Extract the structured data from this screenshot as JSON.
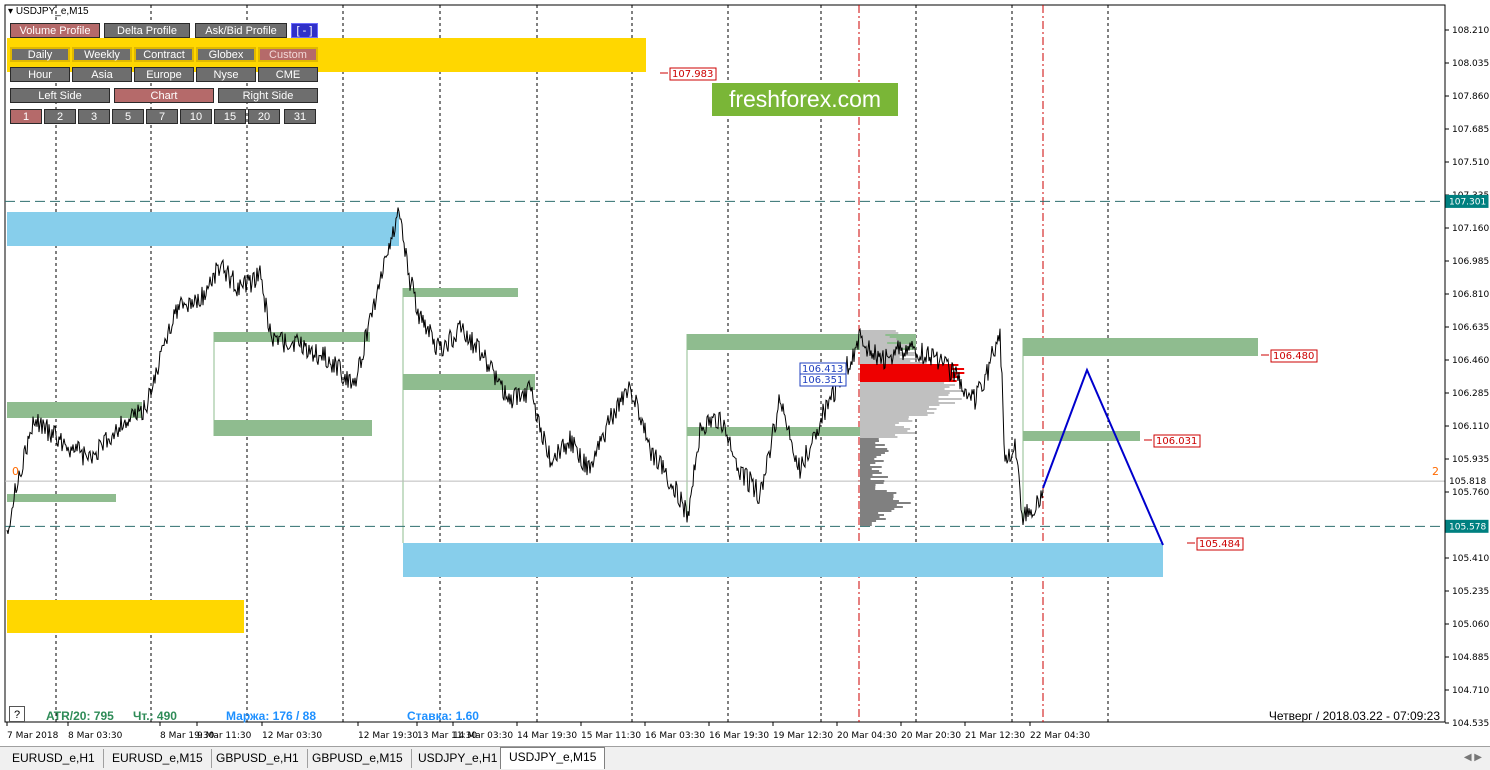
{
  "symbol_title": "USDJPY_e,M15",
  "toolbar": {
    "row1": [
      {
        "label": "Volume Profile",
        "active": true
      },
      {
        "label": "Delta Profile",
        "active": false
      },
      {
        "label": "Ask/Bid Profile",
        "active": false
      },
      {
        "label": "[ - ]",
        "active": false
      }
    ],
    "row2": [
      "Daily",
      "Weekly",
      "Contract",
      "Globex",
      "Custom"
    ],
    "row3": [
      "Hour",
      "Asia",
      "Europe",
      "Nyse",
      "CME"
    ],
    "row4": [
      {
        "label": "Left Side",
        "active": false
      },
      {
        "label": "Chart",
        "active": true
      },
      {
        "label": "Right Side",
        "active": false
      }
    ],
    "row5": [
      "1",
      "2",
      "3",
      "5",
      "7",
      "10",
      "15",
      "20",
      "31"
    ]
  },
  "logo": "freshforex.com",
  "price_axis": [
    "108.210",
    "108.035",
    "107.860",
    "107.685",
    "107.510",
    "107.335",
    "107.160",
    "106.985",
    "106.810",
    "106.635",
    "106.460",
    "106.285",
    "106.110",
    "105.935",
    "105.760",
    "105.585",
    "105.410",
    "105.235",
    "105.060",
    "104.885",
    "104.710",
    "104.535"
  ],
  "price_markers": {
    "level_high": "107.301",
    "current": "105.818",
    "level_low": "105.578"
  },
  "labels": {
    "top_red": "107.983",
    "right_upper": "106.480",
    "right_mid": "106.031",
    "right_low": "105.484",
    "profile_high": "106.413",
    "profile_low": "106.351",
    "left_zero": "0",
    "right_two": "2"
  },
  "time_axis": [
    "7 Mar 2018",
    "8 Mar 03:30",
    "8 Mar 19:30",
    "9 Mar 11:30",
    "12 Mar 03:30",
    "12 Mar 19:30",
    "13 Mar 11:30",
    "14 Mar 03:30",
    "14 Mar 19:30",
    "15 Mar 11:30",
    "16 Mar 03:30",
    "16 Mar 19:30",
    "19 Mar 12:30",
    "20 Mar 04:30",
    "20 Mar 20:30",
    "21 Mar 12:30",
    "22 Mar 04:30"
  ],
  "status": {
    "atr": "ATR/20: 795",
    "cht": "Чт.: 490",
    "margin": "Маржа: 176 / 88",
    "rate": "Ставка: 1.60",
    "datetime": "Четверг  /  2018.03.22  -  07:09:23",
    "help": "?"
  },
  "tabs": [
    {
      "label": "EURUSD_e,H1",
      "active": false
    },
    {
      "label": "EURUSD_e,M15",
      "active": false
    },
    {
      "label": "GBPUSD_e,H1",
      "active": false
    },
    {
      "label": "GBPUSD_e,M15",
      "active": false
    },
    {
      "label": "USDJPY_e,H1",
      "active": false
    },
    {
      "label": "USDJPY_e,M15",
      "active": true
    }
  ],
  "colors": {
    "green_zone": "#8fbc8f",
    "blue_zone": "#87ceeb",
    "gold_zone": "#ffd700",
    "accent_red": "#cc0000",
    "teal_marker": "#008080",
    "forecast_line": "#0000cd",
    "status_green": "#2e8b57",
    "status_blue": "#1e90ff"
  }
}
